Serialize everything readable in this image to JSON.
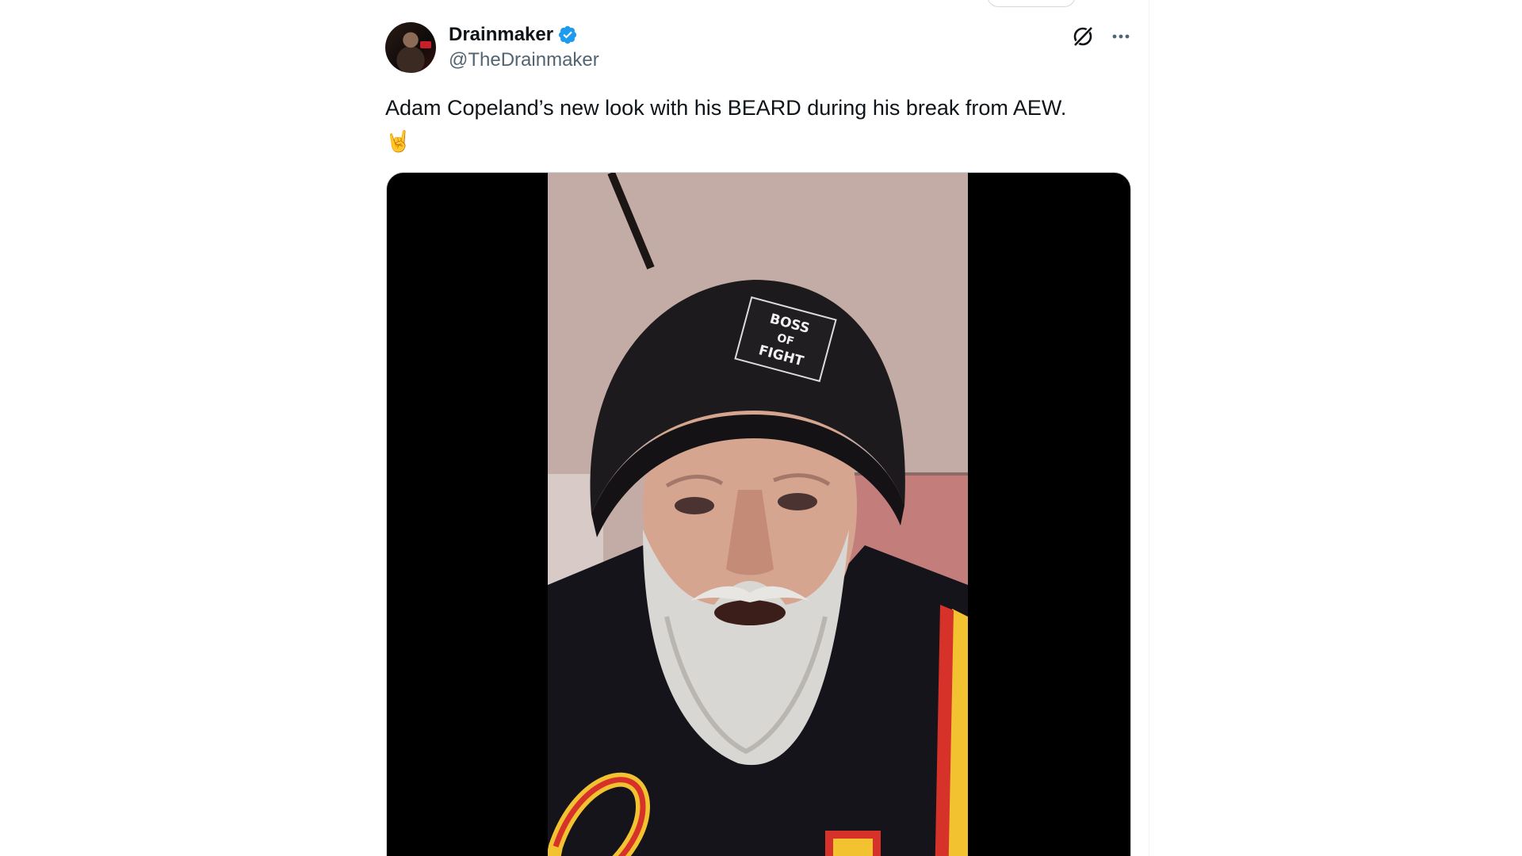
{
  "tweet": {
    "author": {
      "display_name": "Drainmaker",
      "handle": "@TheDrainmaker",
      "verified": true,
      "verified_color": "#1d9bf0"
    },
    "text": "Adam Copeland’s new look with his BEARD during his break from AEW.",
    "emoji": "🤘",
    "actions": {
      "grok_icon": "grok-icon",
      "more_icon": "more-dots-icon"
    },
    "media": {
      "type": "video",
      "background": "#000000"
    }
  },
  "colors": {
    "text_primary": "#0f1419",
    "text_secondary": "#536471",
    "border": "#eff3f4"
  }
}
